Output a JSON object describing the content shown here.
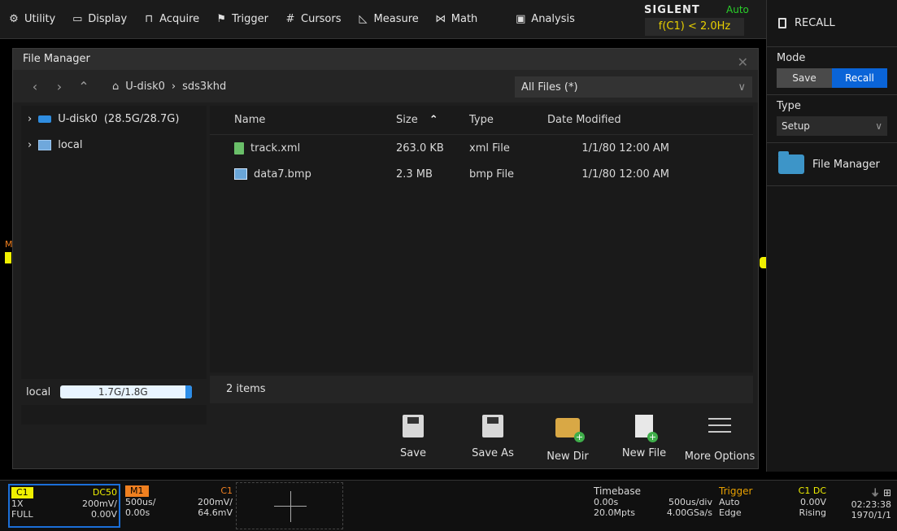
{
  "topmenu": {
    "items": [
      {
        "icon": "gear-icon",
        "glyph": "⚙",
        "label": "Utility"
      },
      {
        "icon": "display-icon",
        "glyph": "▭",
        "label": "Display"
      },
      {
        "icon": "acquire-icon",
        "glyph": "⊓",
        "label": "Acquire"
      },
      {
        "icon": "flag-icon",
        "glyph": "⚑",
        "label": "Trigger"
      },
      {
        "icon": "grid-icon",
        "glyph": "#",
        "label": "Cursors"
      },
      {
        "icon": "measure-icon",
        "glyph": "◺",
        "label": "Measure"
      },
      {
        "icon": "math-icon",
        "glyph": "⋈",
        "label": "Math"
      },
      {
        "icon": "analysis-icon",
        "glyph": "▣",
        "label": "Analysis"
      }
    ],
    "brand": "SIGLENT",
    "run_state": "Auto",
    "freq": "f(C1) < 2.0Hz"
  },
  "right_panel": {
    "title": "RECALL",
    "mode_label": "Mode",
    "mode_options": [
      "Save",
      "Recall"
    ],
    "mode_selected": "Recall",
    "type_label": "Type",
    "type_value": "Setup",
    "file_manager_label": "File Manager"
  },
  "dialog": {
    "title": "File Manager",
    "crumbs": [
      "U-disk0",
      "sds3khd"
    ],
    "filter": "All Files (*)",
    "tree": [
      {
        "label": "U-disk0",
        "size": "(28.5G/28.7G)"
      },
      {
        "label": "local"
      }
    ],
    "columns": [
      "Name",
      "Size",
      "Type",
      "Date Modified"
    ],
    "files": [
      {
        "name": "track.xml",
        "size": "263.0 KB",
        "type": "xml File",
        "date": "1/1/80 12:00 AM",
        "icon": "xml-file-icon"
      },
      {
        "name": "data7.bmp",
        "size": "2.3 MB",
        "type": "bmp File",
        "date": "1/1/80 12:00 AM",
        "icon": "bmp-file-icon"
      }
    ],
    "storage_label": "local",
    "storage_text": "1.7G/1.8G",
    "storage_used_fraction": 0.05,
    "item_count": "2 items",
    "actions": [
      "Save",
      "Save As",
      "New Dir",
      "New File",
      "More Options"
    ]
  },
  "bottom": {
    "c1": {
      "tag": "C1",
      "coupling": "DC50",
      "probe": "1X",
      "bw": "FULL",
      "scale": "200mV/",
      "offset": "0.00V",
      "color": "#f0f000"
    },
    "m1": {
      "tag": "M1",
      "src": "C1",
      "timebase": "500us/",
      "delay": "0.00s",
      "scale": "200mV/",
      "offset": "64.6mV",
      "color": "#f08020"
    },
    "timebase": {
      "label": "Timebase",
      "delay": "0.00s",
      "scale": "500us/div",
      "mpts": "20.0Mpts",
      "rate": "4.00GSa/s"
    },
    "trigger": {
      "label": "Trigger",
      "mode": "Auto",
      "type": "Edge",
      "src": "C1 DC",
      "level": "0.00V",
      "slope": "Rising"
    },
    "clock": {
      "time": "02:23:38",
      "date": "1970/1/1"
    }
  },
  "colors": {
    "accent": "#0a64d8",
    "trigger": "#e8a000",
    "run": "#2ad02a",
    "freq": "#e8d000"
  }
}
